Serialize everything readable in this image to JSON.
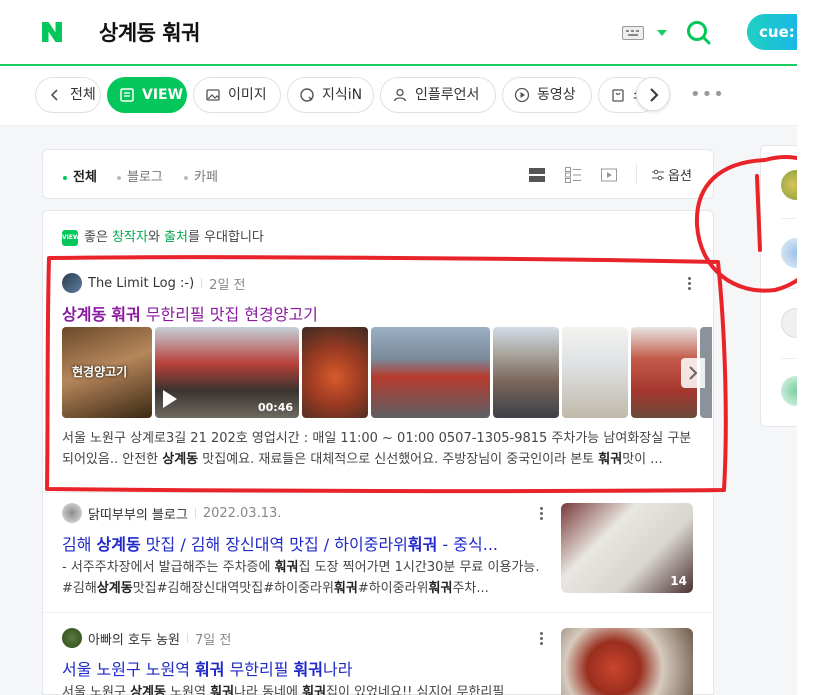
{
  "header": {
    "logo": "N",
    "query": "상계동 훠궈",
    "cue_label": "cue:",
    "icons": [
      "naver-logo-icon",
      "keyboard-icon",
      "dropdown-arrow-icon",
      "search-icon"
    ]
  },
  "tabs": [
    {
      "label": "전체",
      "icon": "chevron-left-icon"
    },
    {
      "label": "VIEW",
      "icon": "view-doc-icon",
      "active": true
    },
    {
      "label": "이미지",
      "icon": "image-icon"
    },
    {
      "label": "지식iN",
      "icon": "kin-icon"
    },
    {
      "label": "인플루언서",
      "icon": "person-icon"
    },
    {
      "label": "동영상",
      "icon": "play-circle-icon"
    },
    {
      "label": "쇼핑",
      "icon": "shopping-bag-icon"
    }
  ],
  "filters": {
    "items": [
      {
        "label": "전체",
        "active": true
      },
      {
        "label": "블로그",
        "active": false
      },
      {
        "label": "카페",
        "active": false
      }
    ],
    "options_label": "옵션"
  },
  "notice": {
    "badge": "VIEW",
    "part1": "좋은 ",
    "creator": "창작자",
    "part2": "와 ",
    "source": "출처",
    "part3": "를 우대합니다"
  },
  "results": [
    {
      "author": "The Limit Log :-)",
      "date": "2일 전",
      "title": {
        "p1": "상계동",
        "p2": " ",
        "p3": "훠궈",
        "p4": " 무한리필 맛집 현경양고기"
      },
      "thumb_video_duration": "00:46",
      "thumb_caption": "현경양고기",
      "desc": {
        "p1": "서울 노원구 상계로3길 21 202호 영업시간 : 매일 11:00 ~ 01:00 0507-1305-9815 주차가능 남여화장실 구분되어있음.. 안전한 ",
        "b1": "상계동",
        "p2": " 맛집예요. 재료들은 대체적으로 신선했어요. 주방장님이 중국인이라 본토 ",
        "b2": "훠궈",
        "p3": "맛이 ..."
      }
    },
    {
      "author": "닭띠부부의 블로그",
      "date": "2022.03.13.",
      "title": {
        "p1": "김해 ",
        "b1": "상계동",
        "p2": " 맛집 / 김해 장신대역 맛집 / 하이중라위",
        "b2": "훠궈",
        "p3": " - 중식..."
      },
      "desc": {
        "p1": "- 서주주차장에서 발급해주는 주차증에 ",
        "b1": "훠궈",
        "p2": "집 도장 찍어가면 1시간30분 무료 이용가능. #김해",
        "b2": "상계동",
        "p3": "맛집#김해장신대역맛집#하이중라위",
        "b3": "훠궈",
        "p4": "#하이중라위",
        "b4": "훠궈",
        "p5": "주차..."
      },
      "image_count": "14"
    },
    {
      "author": "아빠의 호두 농원",
      "date": "7일 전",
      "title": {
        "p1": "서울 노원구 노원역 ",
        "b1": "훠궈",
        "p2": " 무한리필 ",
        "b2": "훠궈",
        "p3": "나라"
      },
      "desc": {
        "p1": "서울 노원구 ",
        "b1": "상계동",
        "p2": " 노원역 ",
        "b2": "훠궈",
        "p3": "나라 동네에 ",
        "b3": "훠궈",
        "p4": "집이 있었네요!! 심지어 무한리필"
      }
    }
  ],
  "annotation": {
    "label": "1",
    "color": "#e8232a"
  },
  "colors": {
    "brand_green": "#03c75a",
    "link_blue": "#2029c8",
    "visited_purple": "#8a1b9f"
  }
}
